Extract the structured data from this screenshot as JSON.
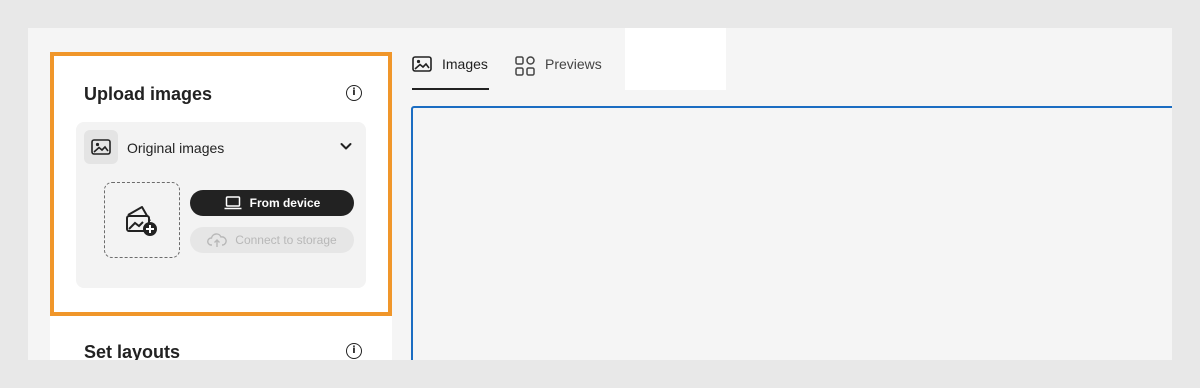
{
  "upload_panel": {
    "title": "Upload images",
    "section_label": "Original images",
    "from_device_label": "From device",
    "connect_storage_label": "Connect to storage"
  },
  "layouts_panel": {
    "title": "Set layouts"
  },
  "tabs": [
    {
      "label": "Images",
      "active": true,
      "icon": "image-icon"
    },
    {
      "label": "Previews",
      "active": false,
      "icon": "grid-icon"
    }
  ],
  "colors": {
    "highlight": "#f0962a",
    "canvas_border": "#1b6dc2",
    "primary_button": "#222222"
  }
}
